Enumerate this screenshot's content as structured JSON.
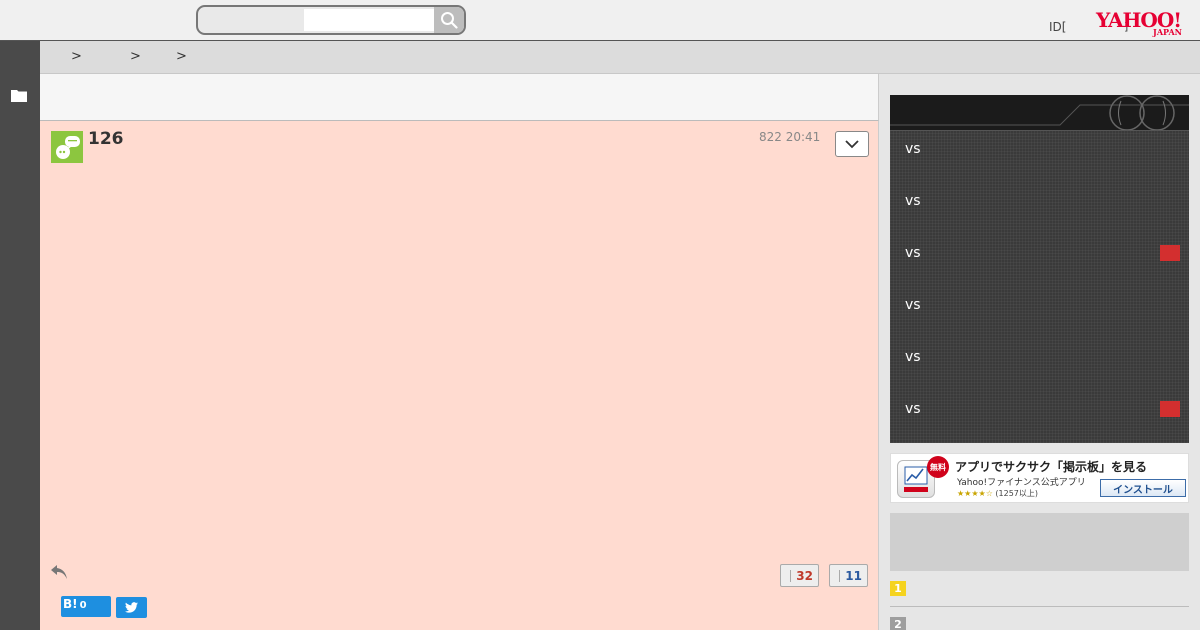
{
  "header": {
    "search_placeholder": "",
    "id_label": "ID[",
    "id_suffix": "]",
    "logo_text": "YAHOO!",
    "logo_sub": "JAPAN"
  },
  "breadcrumb": [
    ">",
    ">",
    ">"
  ],
  "post": {
    "number": "126",
    "timestamp": "822 20:41",
    "votes_up": "32",
    "votes_down": "11",
    "hatena_label": "B!",
    "hatena_count": "0"
  },
  "scoreboard": {
    "games": [
      {
        "vs": "vs",
        "flag": false
      },
      {
        "vs": "vs",
        "flag": false
      },
      {
        "vs": "vs",
        "flag": true
      },
      {
        "vs": "vs",
        "flag": false
      },
      {
        "vs": "vs",
        "flag": false
      },
      {
        "vs": "vs",
        "flag": true
      }
    ],
    "flag_color": "#d32f2f"
  },
  "app_banner": {
    "badge": "無料",
    "title": "アプリでサクサク「掲示板」を見る",
    "subtitle": "Yahoo!ファイナンス公式アプリ",
    "stars": "★★★★☆",
    "rating_count": "(1257以上)",
    "install_label": "インストール"
  },
  "ranking": [
    {
      "num": "1",
      "color": "#f5d31f"
    },
    {
      "num": "2",
      "color": "#9e9e9e"
    }
  ],
  "colors": {
    "post_bg": "#ffdbd0",
    "accent_red": "#e60033",
    "twitter": "#1e8fe0"
  }
}
